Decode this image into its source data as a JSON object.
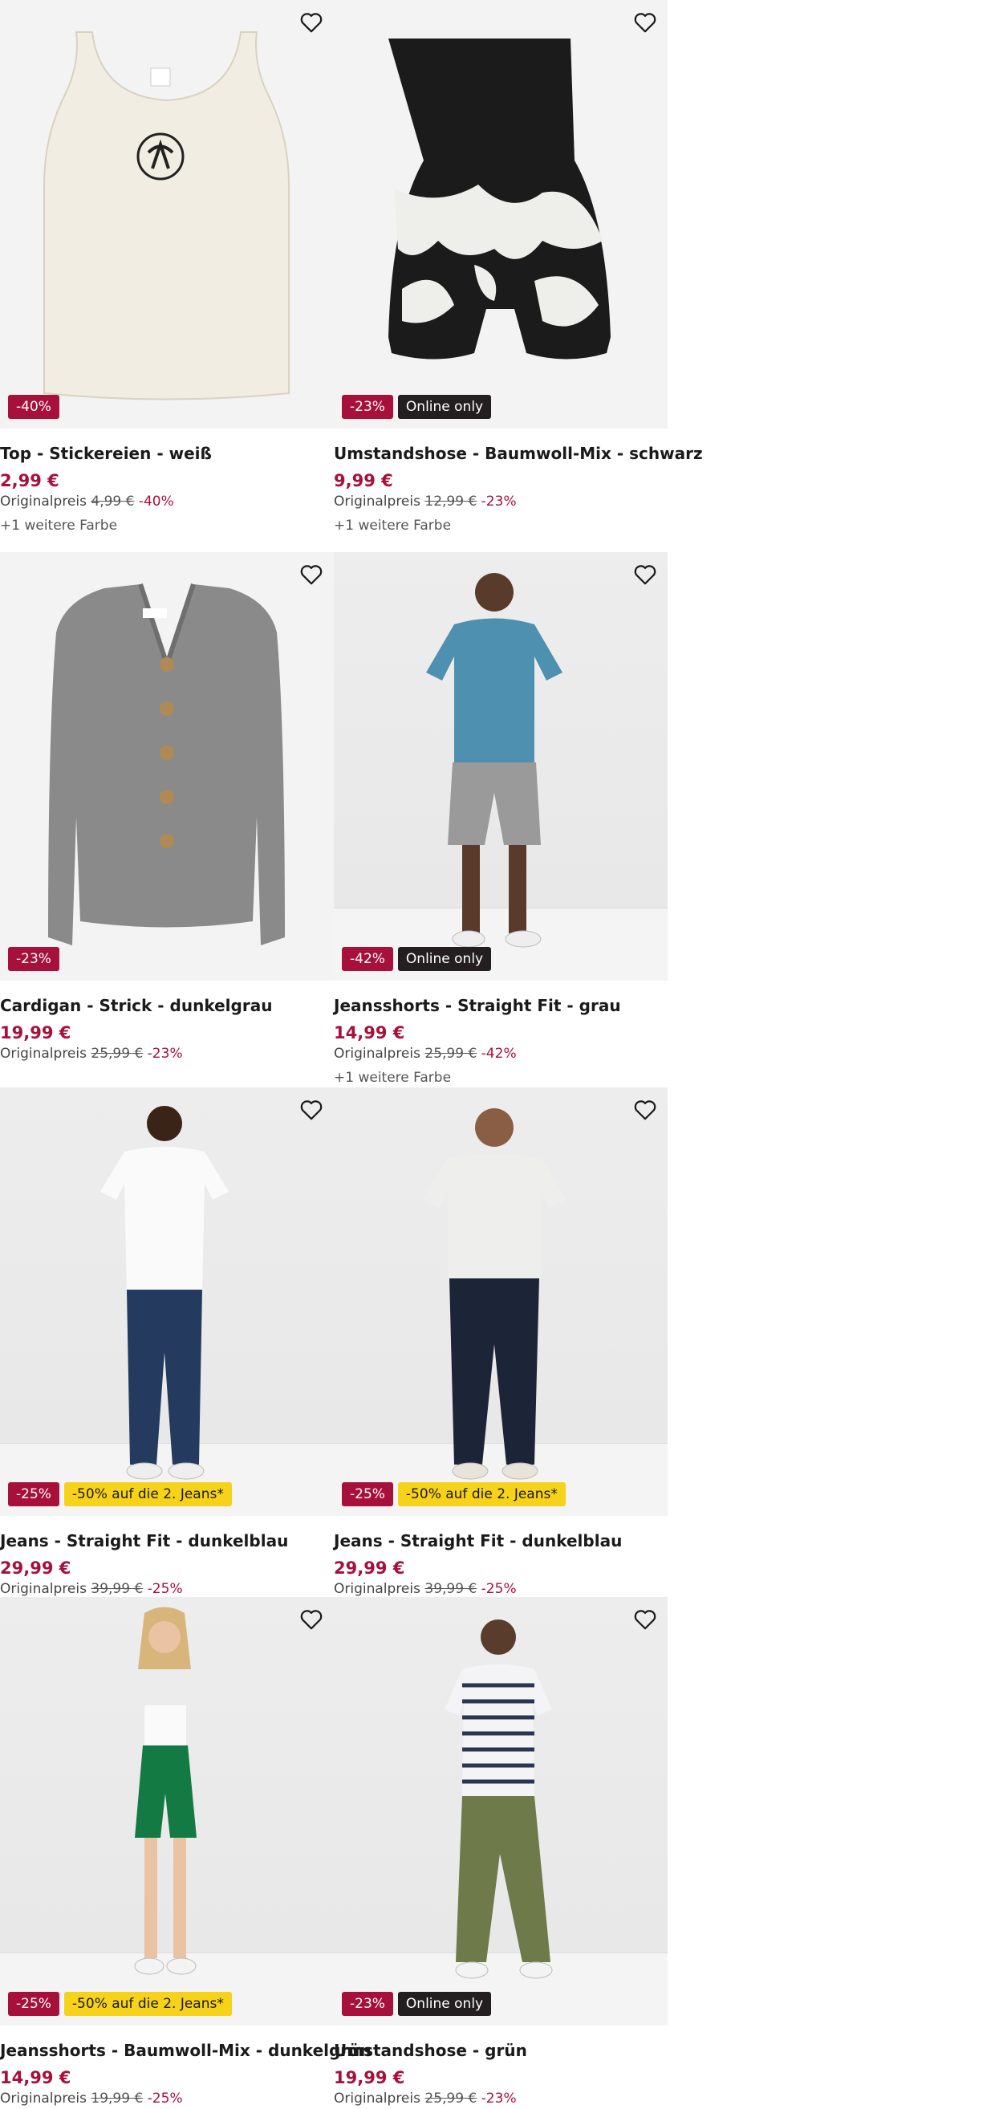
{
  "icons": {
    "favorite": "heart-outline-icon"
  },
  "colors": {
    "sale": "#a8103c",
    "dark_badge": "#231f20",
    "promo_badge": "#f6d21a"
  },
  "products": [
    {
      "title": "Top - Stickereien - weiß",
      "price": "2,99 €",
      "orig_label": "Originalpreis",
      "orig_price": "4,99 €",
      "discount": "-40%",
      "more": "+1 weitere Farbe",
      "badges": [
        "-40%"
      ]
    },
    {
      "title": "Umstandshose - Baumwoll-Mix - schwarz",
      "price": "9,99 €",
      "orig_label": "Originalpreis",
      "orig_price": "12,99 €",
      "discount": "-23%",
      "more": "+1 weitere Farbe",
      "badges": [
        "-23%",
        "Online only"
      ]
    },
    {
      "title": "Cardigan - Strick - dunkelgrau",
      "price": "19,99 €",
      "orig_label": "Originalpreis",
      "orig_price": "25,99 €",
      "discount": "-23%",
      "badges": [
        "-23%"
      ]
    },
    {
      "title": "Jeansshorts - Straight Fit - grau",
      "price": "14,99 €",
      "orig_label": "Originalpreis",
      "orig_price": "25,99 €",
      "discount": "-42%",
      "more": "+1 weitere Farbe",
      "badges": [
        "-42%",
        "Online only"
      ]
    },
    {
      "title": "Jeans - Straight Fit - dunkelblau",
      "price": "29,99 €",
      "orig_label": "Originalpreis",
      "orig_price": "39,99 €",
      "discount": "-25%",
      "badges": [
        "-25%",
        "-50% auf die 2. Jeans*"
      ]
    },
    {
      "title": "Jeans - Straight Fit - dunkelblau",
      "price": "29,99 €",
      "orig_label": "Originalpreis",
      "orig_price": "39,99 €",
      "discount": "-25%",
      "badges": [
        "-25%",
        "-50% auf die 2. Jeans*"
      ]
    },
    {
      "title": "Jeansshorts - Baumwoll-Mix - dunkelgrün",
      "price": "14,99 €",
      "orig_label": "Originalpreis",
      "orig_price": "19,99 €",
      "discount": "-25%",
      "badges": [
        "-25%",
        "-50% auf die 2. Jeans*"
      ]
    },
    {
      "title": "Umstandshose - grün",
      "price": "19,99 €",
      "orig_label": "Originalpreis",
      "orig_price": "25,99 €",
      "discount": "-23%",
      "badges": [
        "-23%",
        "Online only"
      ]
    }
  ]
}
